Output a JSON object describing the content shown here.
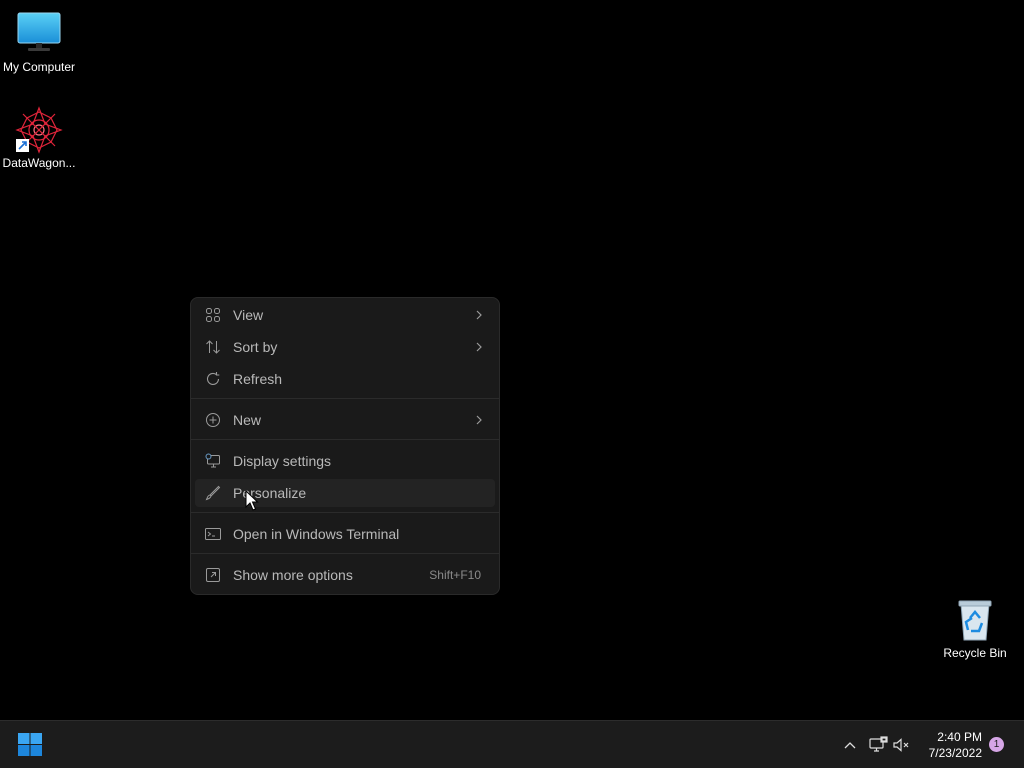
{
  "desktop": {
    "icons": [
      {
        "label": "My Computer",
        "icon": "monitor-icon"
      },
      {
        "label": "DataWagon...",
        "icon": "datawagon-app-icon"
      },
      {
        "label": "Recycle Bin",
        "icon": "recycle-bin-icon"
      }
    ]
  },
  "context_menu": {
    "items": [
      {
        "label": "View",
        "icon": "view-grid-icon",
        "submenu": true
      },
      {
        "label": "Sort by",
        "icon": "sort-icon",
        "submenu": true
      },
      {
        "label": "Refresh",
        "icon": "refresh-icon",
        "submenu": false
      },
      {
        "label": "New",
        "icon": "new-plus-icon",
        "submenu": true
      },
      {
        "label": "Display settings",
        "icon": "display-settings-icon",
        "submenu": false
      },
      {
        "label": "Personalize",
        "icon": "personalize-brush-icon",
        "submenu": false
      },
      {
        "label": "Open in Windows Terminal",
        "icon": "terminal-icon",
        "submenu": false
      },
      {
        "label": "Show more options",
        "icon": "show-more-icon",
        "submenu": false,
        "shortcut": "Shift+F10"
      }
    ]
  },
  "taskbar": {
    "clock": {
      "time": "2:40 PM",
      "date": "7/23/2022"
    },
    "notification_count": "1",
    "tray_icons": [
      "chevron-up-icon",
      "network-icon",
      "volume-muted-icon"
    ]
  },
  "colors": {
    "menu_bg": "#1a1a1a",
    "menu_text": "#b9b9b9",
    "taskbar_bg": "#1c1c1c",
    "accent": "#0a84d8",
    "notification_badge": "#d6a6e6"
  }
}
